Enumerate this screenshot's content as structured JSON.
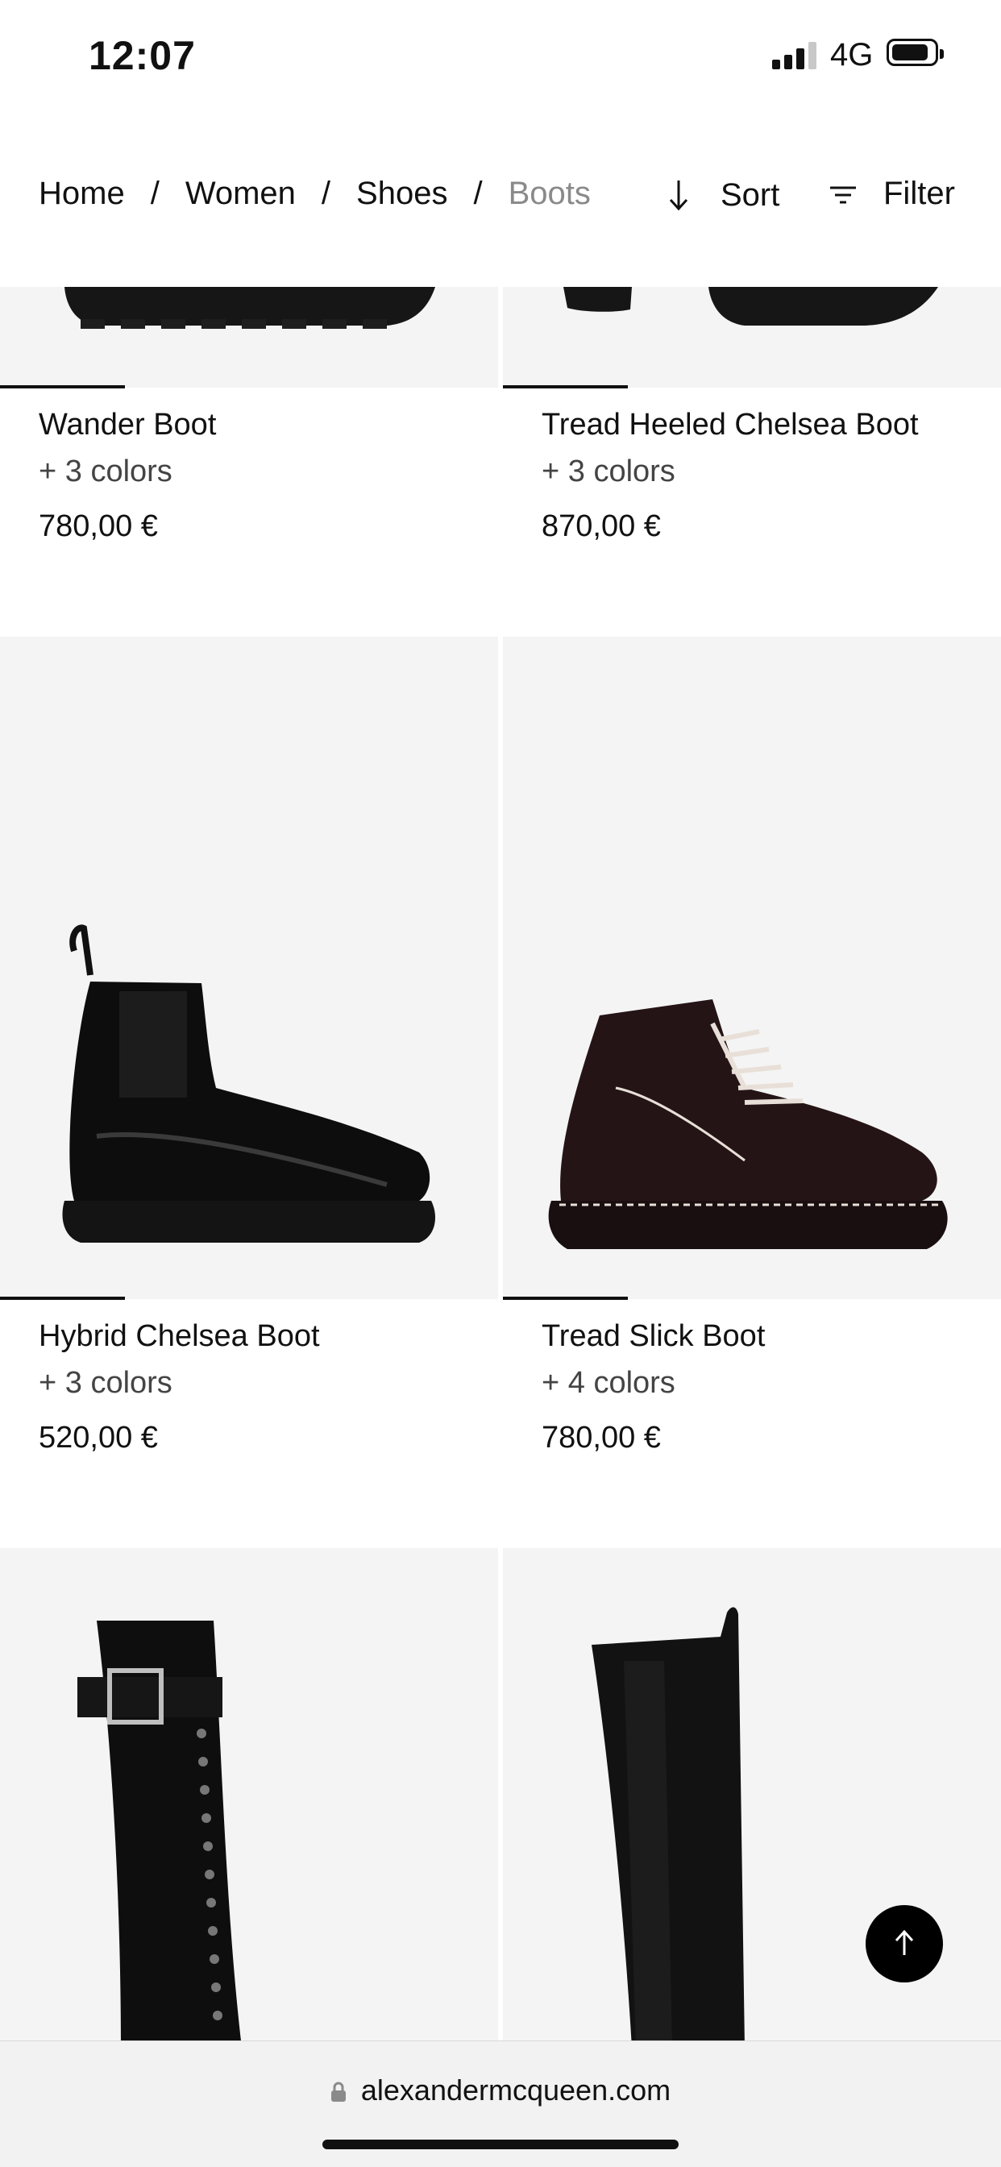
{
  "status_bar": {
    "time": "12:07",
    "network": "4G"
  },
  "breadcrumb": {
    "items": [
      "Home",
      "Women",
      "Shoes",
      "Boots"
    ],
    "separator": "/"
  },
  "toolbar": {
    "sort_label": "Sort",
    "filter_label": "Filter"
  },
  "products": [
    {
      "name": "Wander Boot",
      "colors": "+ 3 colors",
      "price": "780,00 €"
    },
    {
      "name": "Tread Heeled Chelsea Boot",
      "colors": "+ 3 colors",
      "price": "870,00 €"
    },
    {
      "name": "Hybrid Chelsea Boot",
      "colors": "+ 3 colors",
      "price": "520,00 €"
    },
    {
      "name": "Tread Slick Boot",
      "colors": "+ 4 colors",
      "price": "780,00 €"
    }
  ],
  "browser": {
    "url": "alexandermcqueen.com"
  },
  "colors": {
    "accent": "#000000",
    "tile_bg": "#f4f4f4",
    "muted_text": "#8a8a8a"
  }
}
